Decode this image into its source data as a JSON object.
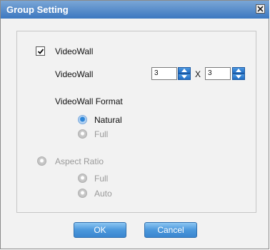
{
  "window": {
    "title": "Group Setting",
    "close_symbol": "×"
  },
  "videowall": {
    "checkbox_label": "VideoWall",
    "checked": true,
    "size_label": "VideoWall",
    "rows": "3",
    "separator": "X",
    "cols": "3",
    "format_label": "VideoWall Format",
    "format_options": [
      "Natural",
      "Full"
    ],
    "format_selected": "Natural"
  },
  "aspect_ratio": {
    "label": "Aspect Ratio",
    "enabled": false,
    "options": [
      "Full",
      "Auto"
    ]
  },
  "buttons": {
    "ok": "OK",
    "cancel": "Cancel"
  },
  "colors": {
    "title_bar": "#3c78c0",
    "button": "#4b98dc",
    "selected_radio": "#2e86d8",
    "disabled_text": "#9a9a9a"
  },
  "icons": {
    "close": "close-icon",
    "checkmark": "checkmark-icon",
    "spin_up": "arrow-up-icon",
    "spin_down": "arrow-down-icon"
  }
}
